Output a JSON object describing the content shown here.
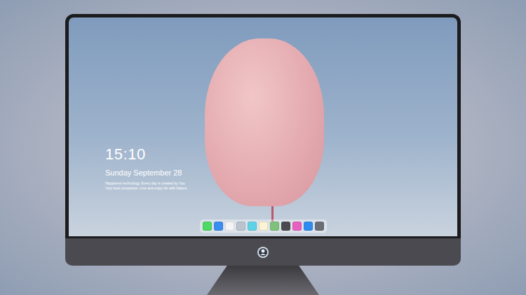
{
  "lock_screen": {
    "time": "15:10",
    "date": "Sunday September 28",
    "caption": [
      "Happiness technology. Every day is created by You.",
      "Your best companion. Live and enjoy life with Nature."
    ]
  },
  "dock": {
    "apps": [
      {
        "color": "#4cd964"
      },
      {
        "color": "#3a8ef0"
      },
      {
        "color": "#f4f4f4"
      },
      {
        "color": "#b9c4cf"
      },
      {
        "color": "#5fd3e6"
      },
      {
        "color": "#fbf3d4"
      },
      {
        "color": "#7fc27a"
      },
      {
        "color": "#4a4a50"
      },
      {
        "color": "#e85fc0"
      },
      {
        "color": "#2e8cf0"
      },
      {
        "color": "#6b6f75"
      }
    ]
  }
}
